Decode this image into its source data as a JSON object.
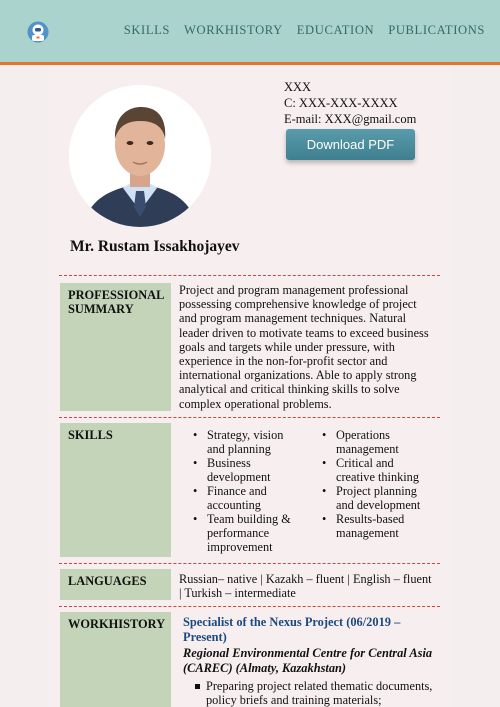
{
  "nav": {
    "items": [
      "SKILLS",
      "WORKHISTORY",
      "EDUCATION",
      "PUBLICATIONS"
    ]
  },
  "header": {
    "line1": "XXX",
    "phone": "C: XXX-XXX-XXXX",
    "email": "E-mail: XXX@gmail.com",
    "download_label": "Download PDF",
    "name": "Mr. Rustam Issakhojayev"
  },
  "summary": {
    "label": "PROFESSIONAL SUMMARY",
    "lines": [
      "Project and program management professional",
      "possessing comprehensive knowledge of project",
      "and program management techniques. Natural",
      "leader driven to motivate teams to exceed business",
      "goals and targets while under pressure, with",
      "experience in the non-for-profit sector and",
      "international organizations. Able to apply strong",
      "analytical and critical thinking skills to solve",
      "complex operational problems."
    ]
  },
  "skills": {
    "label": "SKILLS",
    "col1": [
      [
        "Strategy, vision",
        "and planning"
      ],
      [
        "Business",
        "development"
      ],
      [
        "Finance and",
        "accounting"
      ],
      [
        "Team building &",
        "performance",
        "improvement"
      ]
    ],
    "col2": [
      [
        "Operations",
        "management"
      ],
      [
        "Critical and",
        "creative thinking"
      ],
      [
        "Project planning",
        "and development"
      ],
      [
        "Results-based",
        "management"
      ]
    ]
  },
  "languages": {
    "label": "LANGUAGES",
    "lines": [
      "Russian– native | Kazakh – fluent | English – fluent",
      "| Turkish – intermediate"
    ]
  },
  "workhistory": {
    "label": "WORKHISTORY",
    "title_lines": [
      "Specialist of the Nexus Project (06/2019 –",
      "Present)"
    ],
    "org_lines": [
      "Regional Environmental Centre for Central Asia",
      "(CAREC) (Almaty, Kazakhstan)"
    ],
    "bullets": [
      [
        "Preparing project related thematic documents,",
        "policy briefs and training materials;"
      ]
    ]
  },
  "colors": {
    "topbar": "#a9d3cc",
    "accent_line": "#e5742e",
    "label_bg": "#c3d4b9",
    "divider": "#d2443c",
    "job_title": "#1d4a7e",
    "button": "#4a8c9c"
  },
  "icons": {
    "logo": "astronaut-logo-icon"
  }
}
